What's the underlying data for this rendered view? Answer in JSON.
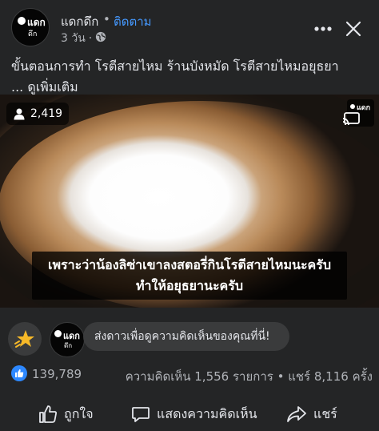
{
  "header": {
    "page_name": "แดกดึก",
    "separator": "•",
    "follow_label": "ติดตาม",
    "time": "3 วัน",
    "meta_dot": "·",
    "avatar_text": "แดก",
    "avatar_subtext": "ดึก",
    "privacy_icon": "globe-icon",
    "more_icon": "more-dots-icon",
    "close_icon": "close-icon"
  },
  "post": {
    "caption": "ขั้นตอนการทำ โรตีสายไหม ร้านบังหมัด โรตีสายไหมอยุธยา",
    "see_more": "... ดูเพิ่มเติม"
  },
  "video": {
    "view_count": "2,419",
    "logo_text": "แดก",
    "subtitle_line1": "เพราะว่าน้องลิซ่าเขาลงสตอรี่กินโรตีสายไหมนะครับ",
    "subtitle_line2": "ทำให้อยุธยานะครับ"
  },
  "comment_prompt": {
    "text": "ส่งดาวเพื่อดูความคิดเห็นของคุณที่นี่!",
    "star_icon": "star-icon",
    "avatar_text": "แดก",
    "avatar_subtext": "ดึก"
  },
  "stats": {
    "like_count": "139,789",
    "comments_shares": "ความคิดเห็น 1,556 รายการ • แชร์ 8,116 ครั้ง"
  },
  "actions": {
    "like_label": "ถูกใจ",
    "comment_label": "แสดงความคิดเห็น",
    "share_label": "แชร์"
  },
  "colors": {
    "background": "#242526",
    "accent": "#4599ff",
    "like_blue": "#2d88ff",
    "text_primary": "#e4e6eb",
    "text_secondary": "#b0b3b8"
  }
}
